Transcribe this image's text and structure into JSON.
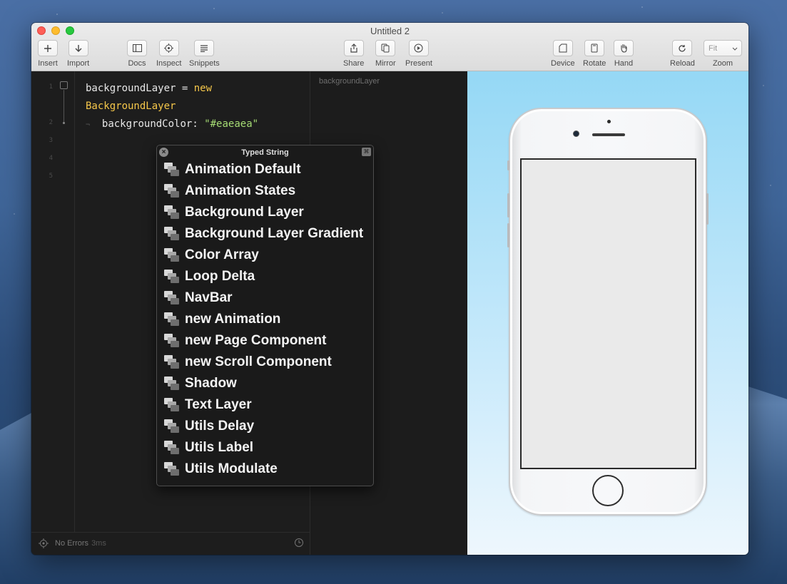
{
  "window": {
    "title": "Untitled 2"
  },
  "toolbar": {
    "insert": "Insert",
    "import": "Import",
    "docs": "Docs",
    "inspect": "Inspect",
    "snippets": "Snippets",
    "share": "Share",
    "mirror": "Mirror",
    "present": "Present",
    "device": "Device",
    "rotate": "Rotate",
    "hand": "Hand",
    "reload": "Reload",
    "zoom_label": "Zoom",
    "zoom_value": "Fit"
  },
  "editor": {
    "line_numbers": [
      "1",
      "2",
      "3",
      "4",
      "5"
    ],
    "code": {
      "var_name": "backgroundLayer",
      "assign": " = ",
      "keyword_new": "new",
      "class_name": "BackgroundLayer",
      "wrap_marker": "¬",
      "prop": "backgroundColor: ",
      "color_value": "\"#eaeaea\""
    },
    "status": {
      "text": "No Errors",
      "time": "3ms"
    }
  },
  "layers_panel": {
    "layer_name": "backgroundLayer"
  },
  "popup": {
    "title": "Typed String",
    "items": [
      "Animation Default",
      "Animation States",
      "Background Layer",
      "Background Layer Gradient",
      "Color Array",
      "Loop Delta",
      "NavBar",
      "new Animation",
      "new Page Component",
      "new Scroll Component",
      "Shadow",
      "Text Layer",
      "Utils Delay",
      "Utils Label",
      "Utils Modulate"
    ]
  },
  "preview": {
    "screen_color": "#eaeaea",
    "background_top": "#95d8f5",
    "background_bottom": "#eef7fd"
  },
  "colors": {
    "keyword": "#f5c74a",
    "string": "#a6dc74",
    "editor_bg": "#1d1d1d"
  }
}
